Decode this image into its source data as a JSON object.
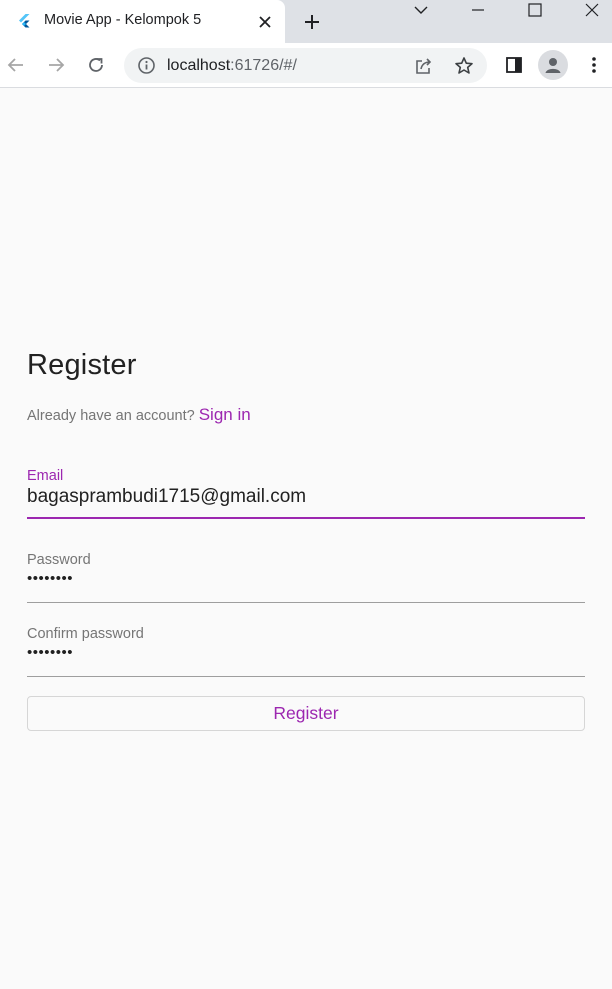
{
  "browser": {
    "tab_title": "Movie App - Kelompok 5",
    "url_host": "localhost",
    "url_path": ":61726/#/"
  },
  "form": {
    "title": "Register",
    "prompt": "Already have an account?",
    "signin_label": "Sign in",
    "email_label": "Email",
    "email_value": "bagasprambudi1715@gmail.com",
    "password_label": "Password",
    "password_value": "••••••••",
    "confirm_label": "Confirm password",
    "confirm_value": "••••••••",
    "submit_label": "Register"
  },
  "colors": {
    "accent": "#9c27b0",
    "page_bg": "#fafafa"
  }
}
